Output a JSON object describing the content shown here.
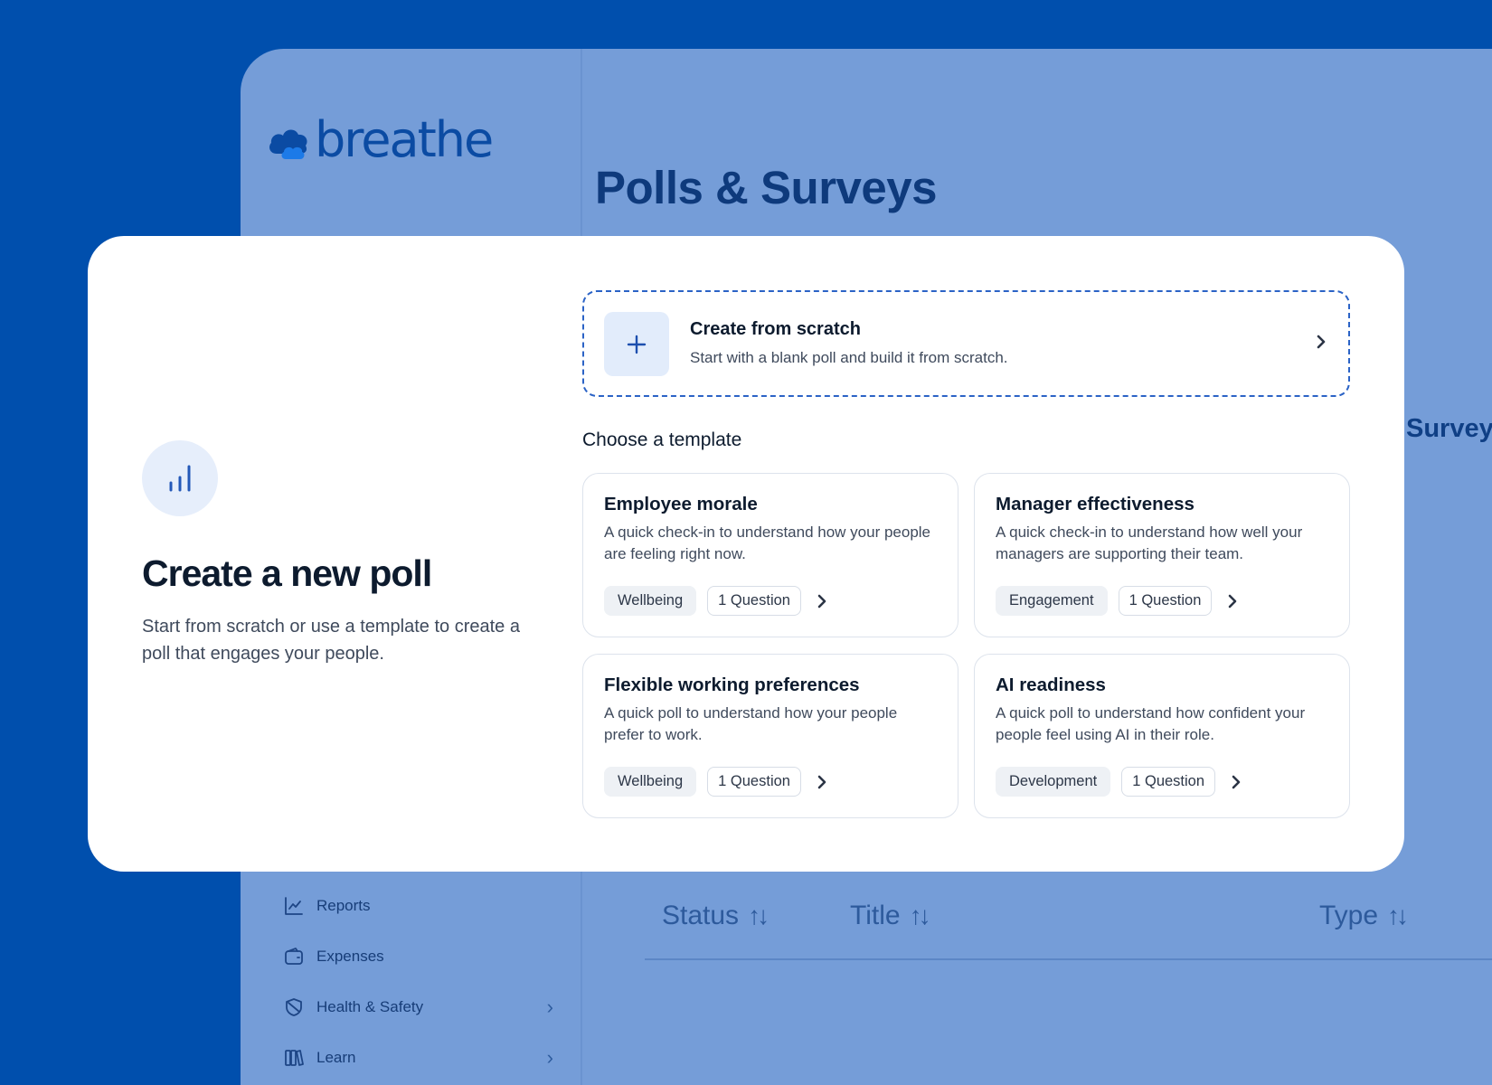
{
  "app": {
    "logo_text": "breathe",
    "page_title": "Polls & Surveys",
    "ghost_text": "Survey",
    "sidebar_items": [
      {
        "label": "Reports",
        "icon": "chart-line-icon",
        "has_chevron": false
      },
      {
        "label": "Expenses",
        "icon": "wallet-icon",
        "has_chevron": false
      },
      {
        "label": "Health & Safety",
        "icon": "shield-icon",
        "has_chevron": true
      },
      {
        "label": "Learn",
        "icon": "books-icon",
        "has_chevron": true
      }
    ],
    "table_columns": [
      {
        "label": "Status"
      },
      {
        "label": "Title"
      },
      {
        "label": "Type"
      }
    ]
  },
  "modal": {
    "icon": "bar-chart-icon",
    "title": "Create a new poll",
    "description": "Start from scratch or use a template to create a poll that engages your people.",
    "scratch": {
      "title": "Create from scratch",
      "description": "Start with a blank poll and build it from scratch."
    },
    "choose_label": "Choose a template",
    "templates": [
      {
        "title": "Employee morale",
        "description": "A quick check-in to understand how your people are feeling right now.",
        "category": "Wellbeing",
        "questions": "1 Question"
      },
      {
        "title": "Manager effectiveness",
        "description": "A quick check-in to understand how well your managers are supporting their team.",
        "category": "Engagement",
        "questions": "1 Question"
      },
      {
        "title": "Flexible working preferences",
        "description": "A quick poll to understand how your people prefer to work.",
        "category": "Wellbeing",
        "questions": "1 Question"
      },
      {
        "title": "AI readiness",
        "description": "A quick poll to understand how confident your people feel using AI in their role.",
        "category": "Development",
        "questions": "1 Question"
      }
    ]
  },
  "colors": {
    "brand_blue": "#004fad",
    "overlay_blue": "#759dd8",
    "accent": "#2b63c6",
    "title_text": "#0d1b2e"
  }
}
